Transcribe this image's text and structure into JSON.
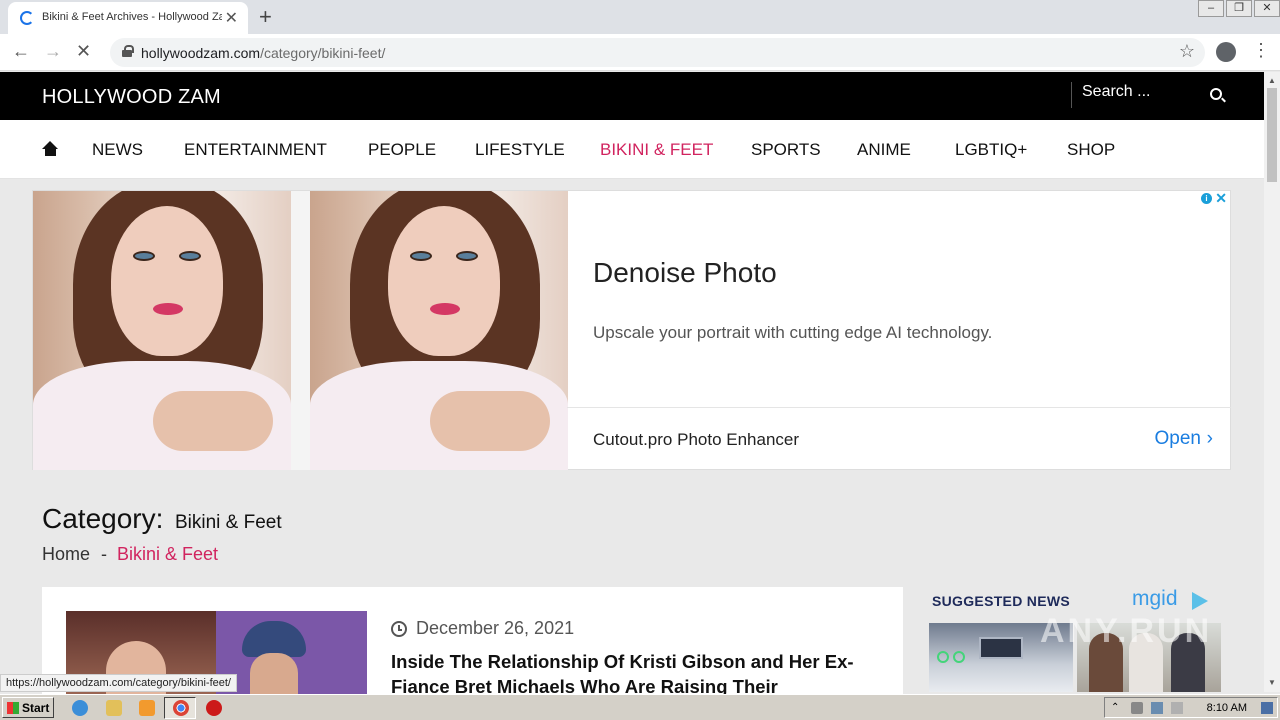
{
  "browser": {
    "tab_title": "Bikini & Feet Archives - Hollywood Zam",
    "new_tab": "+",
    "close_tab": "✕",
    "url_host": "hollywoodzam.com",
    "url_path": "/category/bikini-feet/",
    "status_url": "https://hollywoodzam.com/category/bikini-feet/"
  },
  "site": {
    "logo": "HOLLYWOOD ZAM",
    "search_placeholder": "Search ..."
  },
  "nav": {
    "items": [
      "NEWS",
      "ENTERTAINMENT",
      "PEOPLE",
      "LIFESTYLE",
      "BIKINI & FEET",
      "SPORTS",
      "ANIME",
      "LGBTIQ+",
      "SHOP"
    ],
    "active": "BIKINI & FEET"
  },
  "ad": {
    "title": "Denoise Photo",
    "description": "Upscale your portrait with cutting edge AI technology.",
    "advertiser": "Cutout.pro Photo Enhancer",
    "cta": "Open",
    "info_icon": "i",
    "close_icon": "✕"
  },
  "category": {
    "prefix": "Category:",
    "name": "Bikini & Feet",
    "breadcrumb_home": "Home",
    "breadcrumb_sep": "-",
    "breadcrumb_current": "Bikini & Feet"
  },
  "article": {
    "date": "December 26, 2021",
    "title": "Inside The Relationship Of Kristi Gibson and Her Ex-Fiance Bret Michaels Who Are Raising Their Daughters"
  },
  "sidebar": {
    "heading": "SUGGESTED NEWS",
    "provider": "mgid"
  },
  "taskbar": {
    "start": "Start",
    "time": "8:10 AM"
  },
  "colors": {
    "accent": "#d1245f",
    "header_bg": "#000000",
    "link_blue": "#1a7de0"
  }
}
